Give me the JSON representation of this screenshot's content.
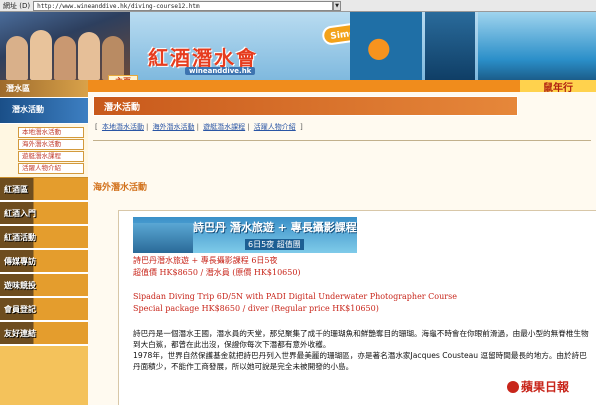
{
  "browser": {
    "address_label": "網址 (D)",
    "url": "http://www.wineanddive.hk/diving-course12.htm"
  },
  "header": {
    "site_name_zh": "紅酒潛水會",
    "site_name_en": "wineanddive.hk",
    "badge": "Simon蔣柏鑑",
    "home": "主頁",
    "slogan": "鼠年行"
  },
  "sidebar": {
    "section": "潛水區",
    "active": "潛水活動",
    "subitems": [
      "本地潛水活動",
      "海外潛水活動",
      "遊艇潛水課程",
      "活躍人物介紹"
    ],
    "categories": [
      "紅酒區",
      "紅酒入門",
      "紅酒活動",
      "傳媒專訪",
      "遊味競投",
      "會員登記",
      "友好連結"
    ]
  },
  "main": {
    "page_title": "潛水活動",
    "subnav": [
      "本地潛水活動",
      "海外潛水活動",
      "遊艇潛水課程",
      "活躍人物介紹"
    ],
    "section_heading": "海外潛水活動",
    "promo_title": "詩巴丹 潛水旅遊 + 專長攝影課程",
    "promo_sub": "6日5夜  超值團",
    "zh_line1": "詩巴丹潛水旅遊 + 專長攝影課程 6日5夜",
    "zh_line2": "超值價 HK$8650 / 潛水員 (原價 HK$10650)",
    "en_line1": "Sipadan Diving Trip 6D/5N with PADI Digital Underwater Photographer Course",
    "en_line2": "Special package HK$8650 / diver (Regular price HK$10650)",
    "para1": "詩巴丹是一個潛水王國，潛水員的天堂，那兒聚集了成千的珊瑚魚和鮮艷奪目的珊瑚。海龜不時會在你眼前滑過，由最小型的無脊椎生物到大白鯊，都曾在此出沒，保證你每次下潛都有意外收穫。",
    "para2": "1978年，世界自然保護基金就把詩巴丹列入世界最美麗的珊瑚區，亦是著名潛水家Jacques Cousteau 逗留時間最長的地方。由於詩巴丹面積少，不能作工商發展，所以她可說是完全未被開發的小島。"
  },
  "watermark": "蘋果日報"
}
